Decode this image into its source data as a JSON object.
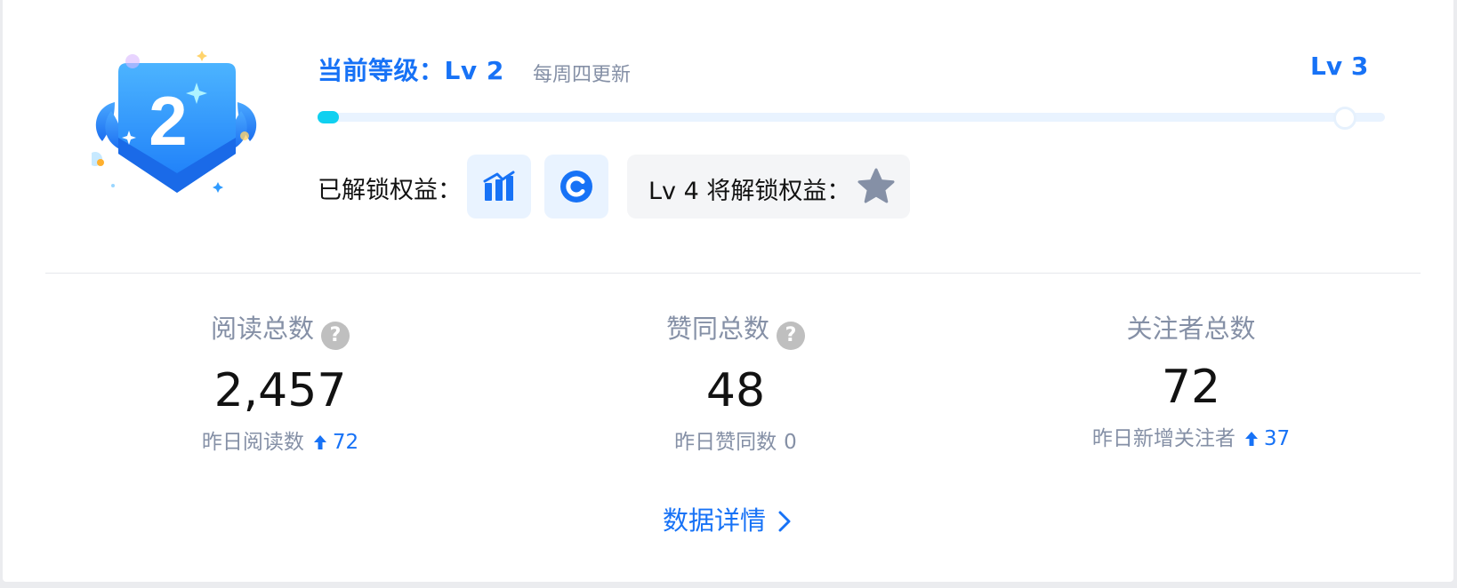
{
  "level": {
    "current_label": "当前等级：Lv 2",
    "update_note": "每周四更新",
    "next_label": "Lv 3",
    "badge_number": "2",
    "progress": 0.02
  },
  "perks": {
    "unlocked_label": "已解锁权益：",
    "unlocked_icons": [
      "chart-perk-icon",
      "copyright-perk-icon"
    ],
    "future_label": "Lv 4 将解锁权益：",
    "future_icon": "star-perk-icon"
  },
  "stats": [
    {
      "title": "阅读总数",
      "value": "2,457",
      "sub_label": "昨日阅读数",
      "sub_value": "72",
      "trend": "up",
      "has_help": true
    },
    {
      "title": "赞同总数",
      "value": "48",
      "sub_label": "昨日赞同数",
      "sub_value": "0",
      "trend": "none",
      "has_help": true
    },
    {
      "title": "关注者总数",
      "value": "72",
      "sub_label": "昨日新增关注者",
      "sub_value": "37",
      "trend": "up",
      "has_help": false
    }
  ],
  "help_glyph": "?",
  "detail_link": "数据详情",
  "colors": {
    "accent": "#1772f6",
    "progress_fill": "#10d0f0",
    "muted": "#8590a6",
    "text": "#121212"
  }
}
